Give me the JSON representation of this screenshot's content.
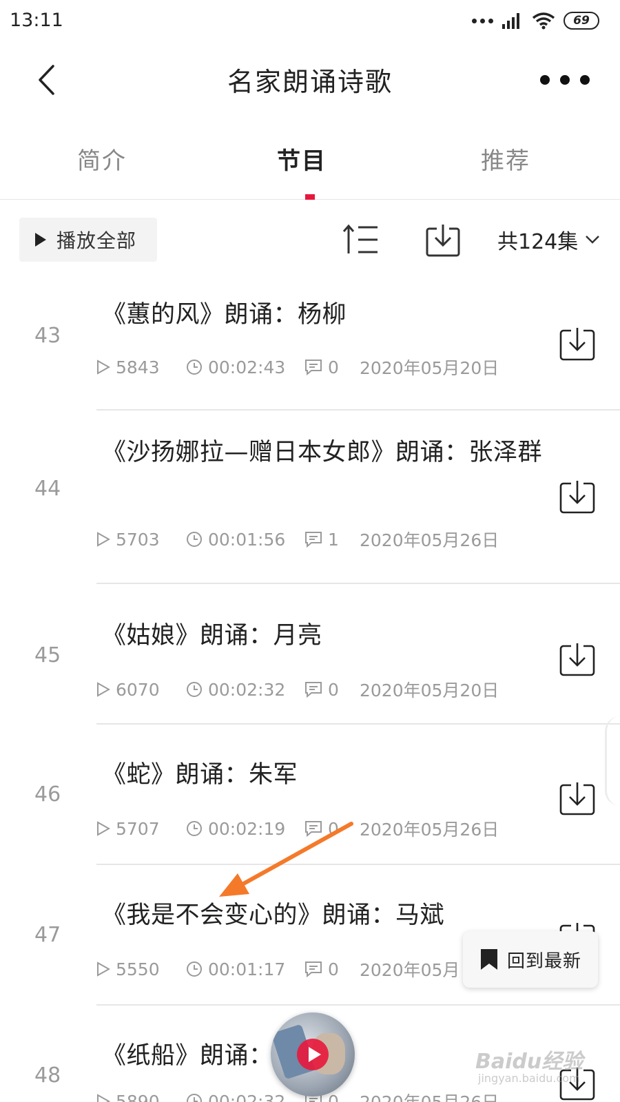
{
  "status_bar": {
    "time": "13:11",
    "battery": "69"
  },
  "header": {
    "title": "名家朗诵诗歌"
  },
  "tabs": [
    {
      "label": "简介",
      "active": false
    },
    {
      "label": "节目",
      "active": true
    },
    {
      "label": "推荐",
      "active": false
    }
  ],
  "toolbar": {
    "play_all_label": "播放全部",
    "episode_count": "共124集"
  },
  "episodes": [
    {
      "num": "43",
      "title": "《蕙的风》朗诵：杨柳",
      "plays": "5843",
      "duration": "00:02:43",
      "comments": "0",
      "date": "2020年05月20日"
    },
    {
      "num": "44",
      "title": "《沙扬娜拉—赠日本女郎》朗诵：张泽群",
      "plays": "5703",
      "duration": "00:01:56",
      "comments": "1",
      "date": "2020年05月26日"
    },
    {
      "num": "45",
      "title": "《姑娘》朗诵：月亮",
      "plays": "6070",
      "duration": "00:02:32",
      "comments": "0",
      "date": "2020年05月20日"
    },
    {
      "num": "46",
      "title": "《蛇》朗诵：朱军",
      "plays": "5707",
      "duration": "00:02:19",
      "comments": "0",
      "date": "2020年05月26日"
    },
    {
      "num": "47",
      "title": "《我是不会变心的》朗诵：马斌",
      "plays": "5550",
      "duration": "00:01:17",
      "comments": "0",
      "date": "2020年05月"
    },
    {
      "num": "48",
      "title": "《纸船》朗诵：",
      "plays": "5890",
      "duration": "00:02:32",
      "comments": "0",
      "date": "2020年05月26日"
    }
  ],
  "floating": {
    "back_latest_label": "回到最新"
  },
  "watermark": {
    "brand": "Baidu经验",
    "url": "jingyan.baidu.com"
  },
  "colors": {
    "accent": "#e8173c",
    "annotation_arrow": "#f47a2a"
  },
  "icons": {
    "back": "chevron-left-icon",
    "more": "more-dots-icon",
    "play": "play-icon",
    "sort": "sort-icon",
    "download": "download-icon",
    "chevron_down": "chevron-down-icon",
    "plays": "play-outline-icon",
    "duration": "clock-icon",
    "comments": "comment-icon",
    "bookmark": "bookmark-icon"
  }
}
